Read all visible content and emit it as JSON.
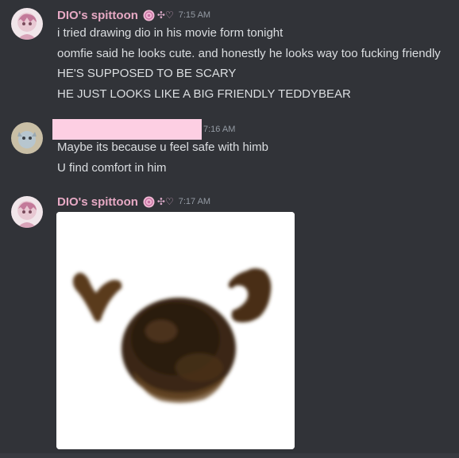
{
  "messages": [
    {
      "username": "DIO's spittoon",
      "tag": "✣♡",
      "time": "7:15 AM",
      "lines": [
        "i tried drawing dio in his movie form tonight",
        "oomfie said he looks cute. and honestly he looks way too fucking friendly",
        "HE'S SUPPOSED TO BE SCARY",
        "HE JUST LOOKS LIKE A BIG FRIENDLY TEDDYBEAR"
      ]
    },
    {
      "username": "",
      "time": "7:16 AM",
      "lines": [
        "Maybe its because u feel safe with himb",
        "U find comfort in him"
      ]
    },
    {
      "username": "DIO's spittoon",
      "tag": "✣♡",
      "time": "7:17 AM",
      "attachment": {
        "icon": "blurry-brown-creature-image"
      }
    }
  ],
  "colors": {
    "background": "#313338",
    "username": "#e6a9c4",
    "text": "#dbdee1",
    "timestamp": "#949ba4",
    "redaction": "#fdcfe3"
  }
}
